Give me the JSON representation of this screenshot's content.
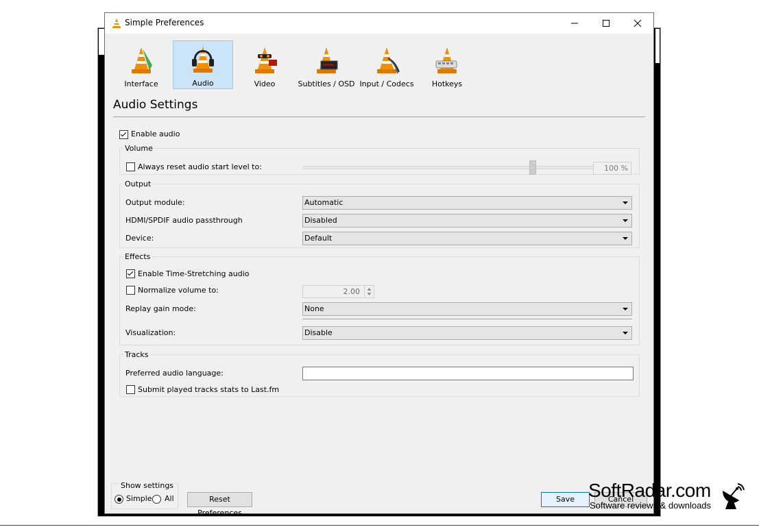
{
  "window": {
    "title": "Simple Preferences"
  },
  "tabs": [
    {
      "label": "Interface",
      "icon": "vlc-cone-icon"
    },
    {
      "label": "Audio",
      "icon": "headphones-cone-icon",
      "active": true
    },
    {
      "label": "Video",
      "icon": "video-cone-icon"
    },
    {
      "label": "Subtitles / OSD",
      "icon": "subtitles-cone-icon"
    },
    {
      "label": "Input / Codecs",
      "icon": "codecs-cone-icon"
    },
    {
      "label": "Hotkeys",
      "icon": "hotkeys-cone-icon"
    }
  ],
  "heading": "Audio Settings",
  "enable_audio": {
    "label": "Enable audio",
    "checked": true
  },
  "volume": {
    "title": "Volume",
    "reset_label": "Always reset audio start level to:",
    "reset_checked": false,
    "level_value": "100 %",
    "level_percent": 100
  },
  "output": {
    "title": "Output",
    "module_label": "Output module:",
    "module_value": "Automatic",
    "passthrough_label": "HDMI/SPDIF audio passthrough",
    "passthrough_value": "Disabled",
    "device_label": "Device:",
    "device_value": "Default"
  },
  "effects": {
    "title": "Effects",
    "stretch_label": "Enable Time-Stretching audio",
    "stretch_checked": true,
    "normalize_label": "Normalize volume to:",
    "normalize_checked": false,
    "normalize_value": "2.00",
    "replay_label": "Replay gain mode:",
    "replay_value": "None",
    "visualization_label": "Visualization:",
    "visualization_value": "Disable"
  },
  "tracks": {
    "title": "Tracks",
    "language_label": "Preferred audio language:",
    "language_value": "",
    "lastfm_label": "Submit played tracks stats to Last.fm",
    "lastfm_checked": false
  },
  "footer": {
    "show_settings_title": "Show settings",
    "simple_label": "Simple",
    "all_label": "All",
    "selected": "Simple",
    "reset_label": "Reset Preferences",
    "save_label": "Save",
    "cancel_label": "Cancel"
  },
  "watermark": {
    "title": "SoftRadar.com",
    "subtitle": "Software reviews & downloads"
  },
  "colors": {
    "active_tab_bg": "#cce4f7",
    "dialog_bg": "#f0f0f0",
    "cone_orange": "#f29000"
  }
}
